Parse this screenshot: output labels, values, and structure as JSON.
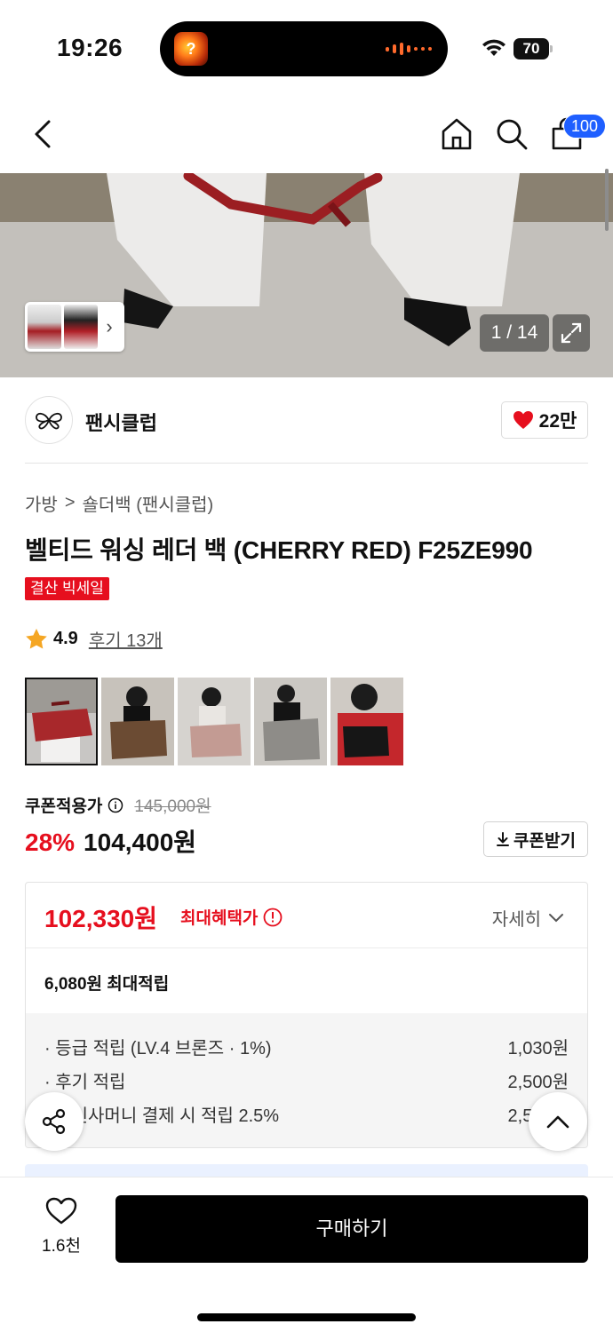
{
  "status_bar": {
    "time": "19:26",
    "battery": "70",
    "island_app_glyph": "?"
  },
  "nav": {
    "cart_count": "100"
  },
  "hero": {
    "page_counter": "1 / 14",
    "current_page": 1,
    "total_pages": 14
  },
  "brand": {
    "name": "팬시클럽",
    "likes": "22만"
  },
  "breadcrumb": {
    "category": "가방",
    "subcategory": "숄더백 (팬시클럽)",
    "separator": ">"
  },
  "product": {
    "title": "벨티드 워싱 레더 백 (CHERRY RED) F25ZE990",
    "badge": "결산 빅세일",
    "rating": "4.9",
    "review_link": "후기 13개"
  },
  "thumbnails": [
    {
      "label": "cherry-red-bag"
    },
    {
      "label": "brown-bag"
    },
    {
      "label": "pink-bag"
    },
    {
      "label": "grey-bag"
    },
    {
      "label": "black-bag"
    }
  ],
  "pricing": {
    "coupon_label": "쿠폰적용가",
    "original_price": "145,000원",
    "discount": "28%",
    "sale_price": "104,400원",
    "coupon_button": "쿠폰받기"
  },
  "benefits": {
    "max_price": "102,330원",
    "max_label": "최대혜택가",
    "detail_label": "자세히",
    "points_total": "6,080원 최대적립",
    "items": [
      {
        "label": "· 등급 적립 (LV.4 브론즈 · 1%)",
        "value": "1,030원"
      },
      {
        "label": "· 후기 적립",
        "value": "2,500원"
      },
      {
        "label": "· 무신사머니 결제 시 적립 2.5%",
        "value": "2,550원"
      }
    ]
  },
  "bottom": {
    "wish_count": "1.6천",
    "buy_label": "구매하기"
  },
  "colors": {
    "accent_red": "#e60f1e",
    "badge_blue": "#1f5fff",
    "buy_button": "#000000"
  },
  "icons": [
    "back-icon",
    "home-icon",
    "search-icon",
    "bag-icon",
    "expand-icon",
    "heart-icon",
    "star-icon",
    "info-icon",
    "download-icon",
    "chevron-down-icon",
    "share-icon",
    "chevron-up-icon",
    "wifi-icon"
  ]
}
